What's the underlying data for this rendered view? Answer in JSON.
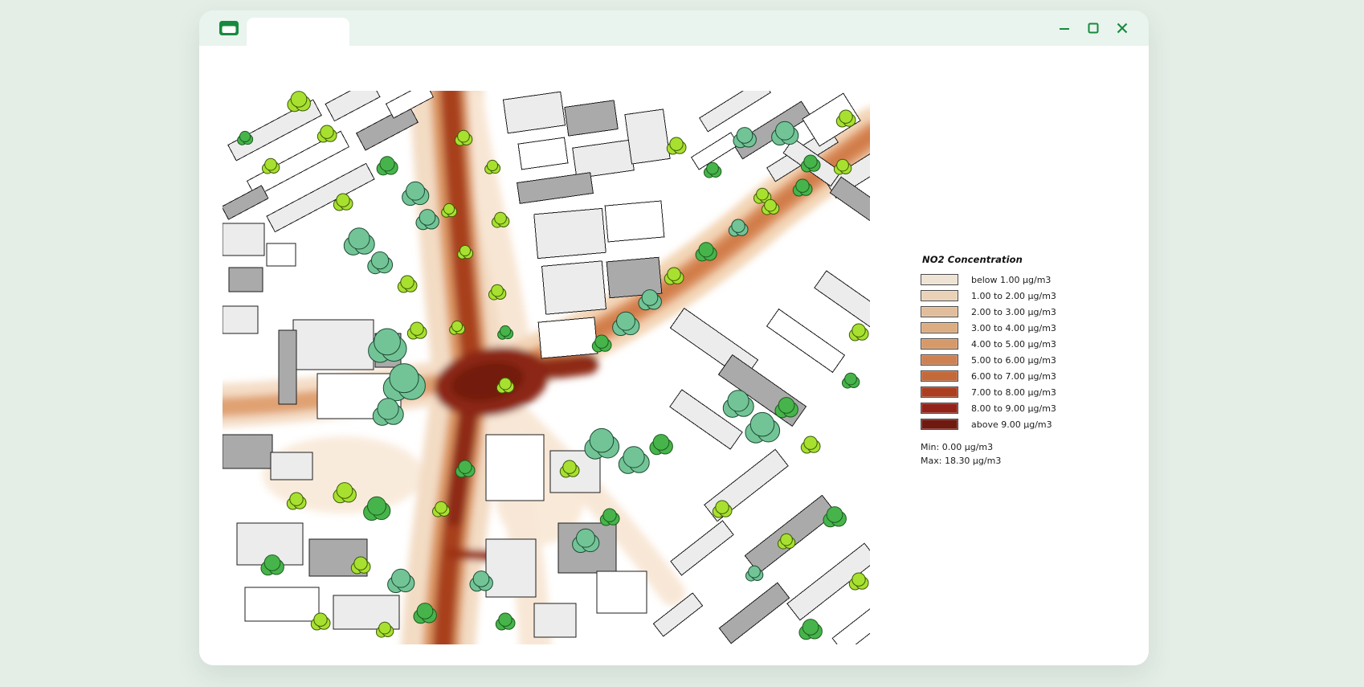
{
  "window": {
    "tab_label": "",
    "controls": [
      {
        "name": "minimize",
        "icon": "minimize-icon"
      },
      {
        "name": "maximize",
        "icon": "maximize-icon"
      },
      {
        "name": "close",
        "icon": "close-icon"
      }
    ]
  },
  "colors": {
    "page_background": "#e4eee7",
    "titlebar_background": "#e9f4ee",
    "accent_green": "#178a3e",
    "plume_max": "#6f1a10"
  },
  "legend": {
    "title": "NO2 Concentration",
    "entries": [
      {
        "label": "below 1.00 µg/m3",
        "color": "#eee3d4"
      },
      {
        "label": "1.00 to 2.00 µg/m3",
        "color": "#e9d2b8"
      },
      {
        "label": "2.00 to 3.00 µg/m3",
        "color": "#e1bd9b"
      },
      {
        "label": "3.00 to 4.00 µg/m3",
        "color": "#dcac82"
      },
      {
        "label": "4.00 to 5.00 µg/m3",
        "color": "#d6996a"
      },
      {
        "label": "5.00 to 6.00 µg/m3",
        "color": "#ce8253"
      },
      {
        "label": "6.00 to 7.00 µg/m3",
        "color": "#c46939"
      },
      {
        "label": "7.00 to 8.00 µg/m3",
        "color": "#ac3e22"
      },
      {
        "label": "8.00 to 9.00 µg/m3",
        "color": "#91231a"
      },
      {
        "label": "above 9.00 µg/m3",
        "color": "#6f1a10"
      }
    ],
    "min_label": "Min: 0.00 µg/m3",
    "max_label": "Max: 18.30 µg/m3"
  }
}
